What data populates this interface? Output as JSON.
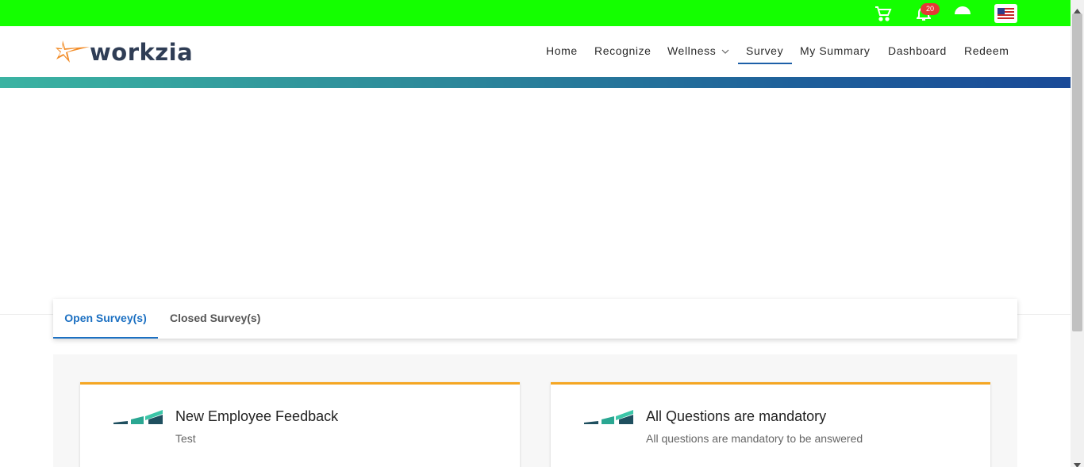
{
  "topbar": {
    "background": "#14ff00",
    "notification_count": "20",
    "icons": [
      "cart-icon",
      "bell-icon",
      "user-icon",
      "us-flag-icon"
    ]
  },
  "header": {
    "logo_text": "workzia",
    "nav": [
      {
        "label": "Home",
        "active": false
      },
      {
        "label": "Recognize",
        "active": false
      },
      {
        "label": "Wellness",
        "active": false,
        "has_dropdown": true
      },
      {
        "label": "Survey",
        "active": true
      },
      {
        "label": "My Summary",
        "active": false
      },
      {
        "label": "Dashboard",
        "active": false
      },
      {
        "label": "Redeem",
        "active": false
      }
    ]
  },
  "tabs": {
    "open_label": "Open Survey(s)",
    "closed_label": "Closed Survey(s)",
    "active": "open"
  },
  "surveys": [
    {
      "title": "New Employee Feedback",
      "description": "Test"
    },
    {
      "title": "All Questions are mandatory",
      "description": "All questions are mandatory to be answered"
    }
  ],
  "colors": {
    "accent": "#1c70c2",
    "card_border": "#f5a623",
    "active_nav_underline": "#1d5fa8",
    "badge": "#e53935"
  }
}
